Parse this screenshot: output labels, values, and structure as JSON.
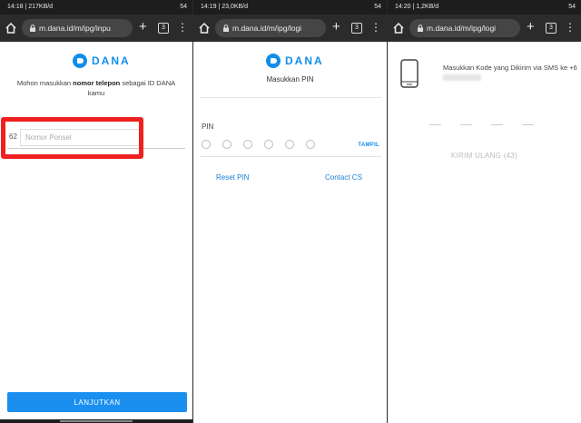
{
  "screens": [
    {
      "status": {
        "time_net": "14:18 | 217KB/d",
        "battery": "54"
      },
      "browser": {
        "url": "m.dana.id/m/ipg/inpu",
        "tab_count": "3"
      },
      "logo": "DANA",
      "prompt": {
        "before": "Mohon masukkan ",
        "bold": "nomor telepon",
        "after": " sebagai ID DANA kamu"
      },
      "phone": {
        "prefix": "62",
        "placeholder": "Nomor Ponsel"
      },
      "continue_label": "LANJUTKAN"
    },
    {
      "status": {
        "time_net": "14:19 | 23,0KB/d",
        "battery": "54"
      },
      "browser": {
        "url": "m.dana.id/m/ipg/logi",
        "tab_count": "3"
      },
      "logo": "DANA",
      "title": "Masukkan PIN",
      "pin_label": "PIN",
      "show_label": "TAMPIL",
      "reset_label": "Reset PIN",
      "contact_label": "Contact CS"
    },
    {
      "status": {
        "time_net": "14:20 | 1,2KB/d",
        "battery": "54"
      },
      "browser": {
        "url": "m.dana.id/m/ipg/logi",
        "tab_count": "3"
      },
      "otp_message": "Masukkan Kode yang Dikirim via SMS ke +6",
      "resend_label": "KIRIM ULANG (43)"
    }
  ],
  "colors": {
    "brand": "#118EEA",
    "button": "#1A8FF0",
    "highlight": "#EE2020",
    "chrome": "#2B2B2B"
  },
  "icons": [
    "home-icon",
    "lock-icon",
    "plus-icon",
    "tab-switcher-icon",
    "more-menu-icon",
    "dana-logo-icon",
    "phone-device-icon"
  ]
}
